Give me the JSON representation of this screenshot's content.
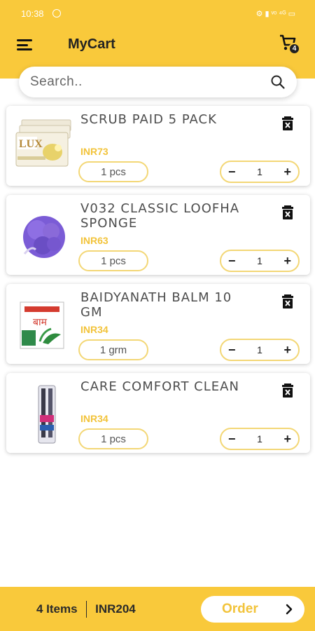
{
  "status_bar": {
    "time": "10:38",
    "right": "⚙ ▮ ᵛᵒ ⁴ᴳ ▭"
  },
  "header": {
    "title": "MyCart",
    "cart_count": "4"
  },
  "search": {
    "placeholder": "Search.."
  },
  "items": [
    {
      "name": "SCRUB PAID 5 PACK",
      "price": "INR73",
      "unit": "1 pcs",
      "qty": "1"
    },
    {
      "name": "V032 CLASSIC LOOFHA SPONGE",
      "price": "INR63",
      "unit": "1 pcs",
      "qty": "1"
    },
    {
      "name": "BAIDYANATH BALM 10 GM",
      "price": "INR34",
      "unit": "1 grm",
      "qty": "1"
    },
    {
      "name": "CARE COMFORT CLEAN",
      "price": "INR34",
      "unit": "1 pcs",
      "qty": "1"
    }
  ],
  "footer": {
    "items_count": "4 Items",
    "total": "INR204",
    "order_label": "Order"
  },
  "colors": {
    "accent": "#f9c93b",
    "price": "#f2c33a",
    "pill_border": "#f3d776"
  }
}
